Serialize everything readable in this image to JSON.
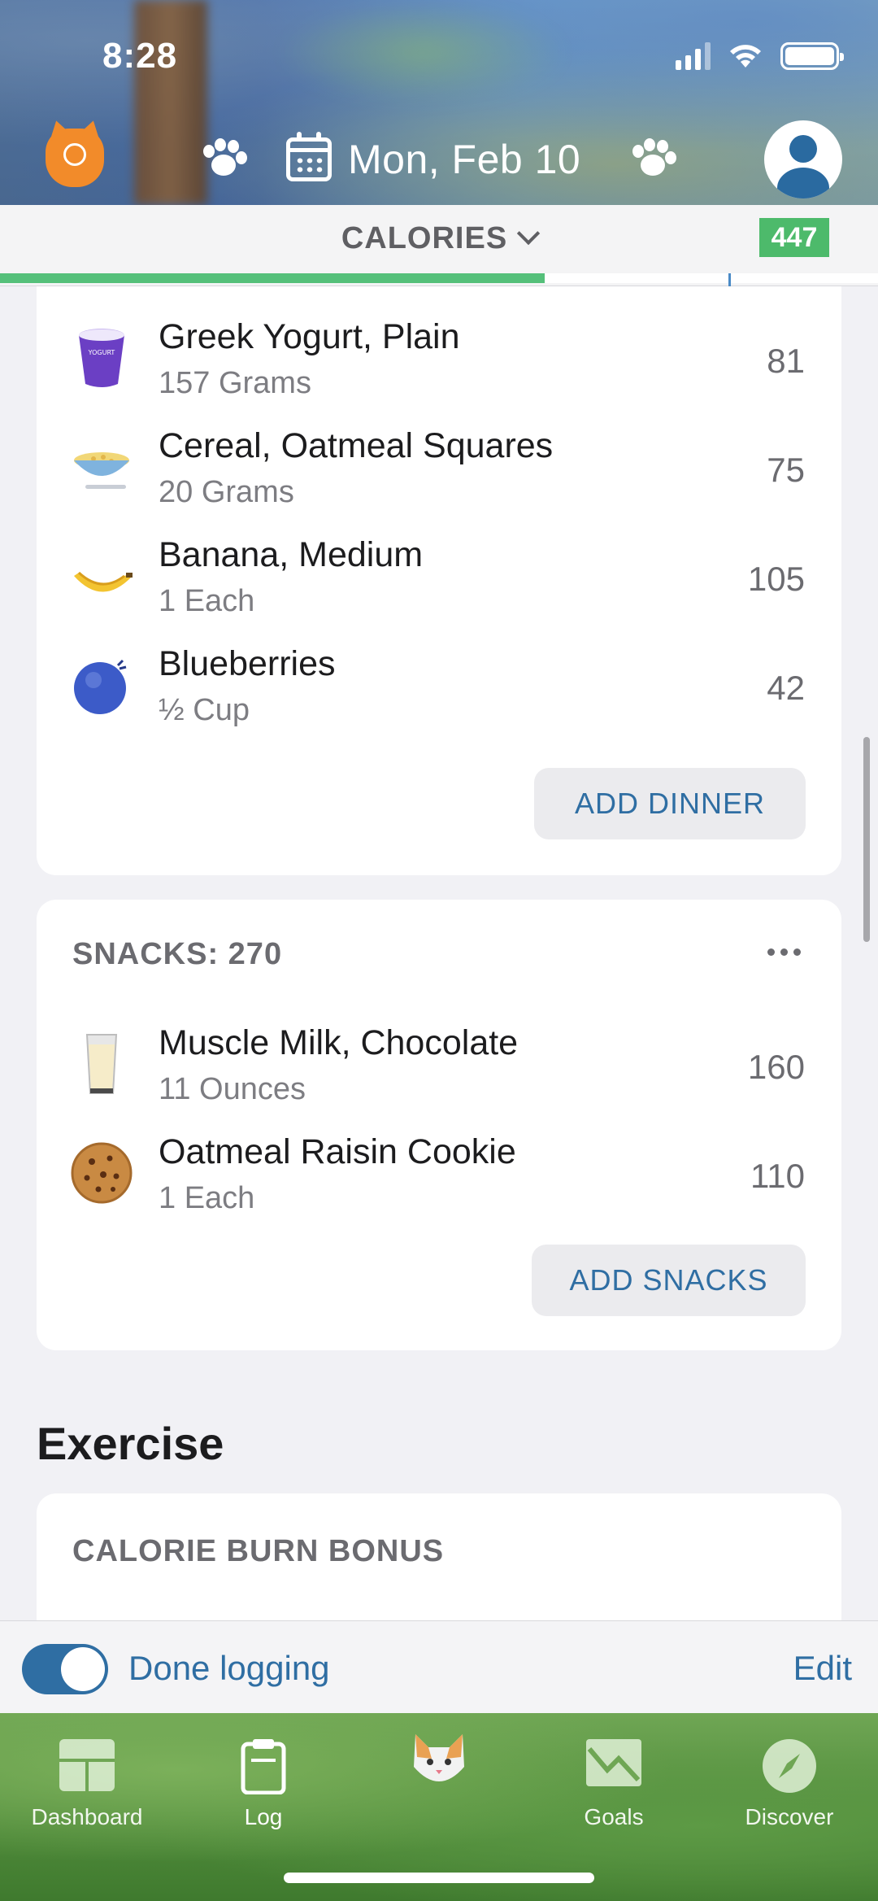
{
  "status_bar": {
    "time": "8:28"
  },
  "header": {
    "date": "Mon, Feb 10"
  },
  "calories_bar": {
    "title": "CALORIES",
    "remaining_badge": "447",
    "progress_fraction": 0.62
  },
  "dinner": {
    "items": [
      {
        "name": "Greek Yogurt, Plain",
        "amount": "157 Grams",
        "calories": "81",
        "icon": "yogurt-icon"
      },
      {
        "name": "Cereal, Oatmeal Squares",
        "amount": "20 Grams",
        "calories": "75",
        "icon": "cereal-bowl-icon"
      },
      {
        "name": "Banana, Medium",
        "amount": "1 Each",
        "calories": "105",
        "icon": "banana-icon"
      },
      {
        "name": "Blueberries",
        "amount": "½ Cup",
        "calories": "42",
        "icon": "blueberry-icon"
      }
    ],
    "add_label": "ADD DINNER"
  },
  "snacks": {
    "header": "SNACKS: 270",
    "items": [
      {
        "name": "Muscle Milk, Chocolate",
        "amount": "11 Ounces",
        "calories": "160",
        "icon": "milk-glass-icon"
      },
      {
        "name": "Oatmeal Raisin Cookie",
        "amount": "1 Each",
        "calories": "110",
        "icon": "cookie-icon"
      }
    ],
    "add_label": "ADD SNACKS"
  },
  "exercise": {
    "title": "Exercise",
    "section_header": "CALORIE BURN BONUS"
  },
  "done_bar": {
    "toggle_label": "Done logging",
    "edit_label": "Edit",
    "toggle_on": true
  },
  "tabs": [
    {
      "label": "Dashboard",
      "icon": "dashboard-icon"
    },
    {
      "label": "Log",
      "icon": "clipboard-icon"
    },
    {
      "label": "",
      "icon": "cat-mascot-icon"
    },
    {
      "label": "Goals",
      "icon": "goals-chart-icon"
    },
    {
      "label": "Discover",
      "icon": "compass-icon"
    }
  ],
  "colors": {
    "accent_blue": "#2f6ea3",
    "progress_green": "#55c07a",
    "badge_green": "#4dba6b",
    "cat_orange": "#f28b2a"
  }
}
